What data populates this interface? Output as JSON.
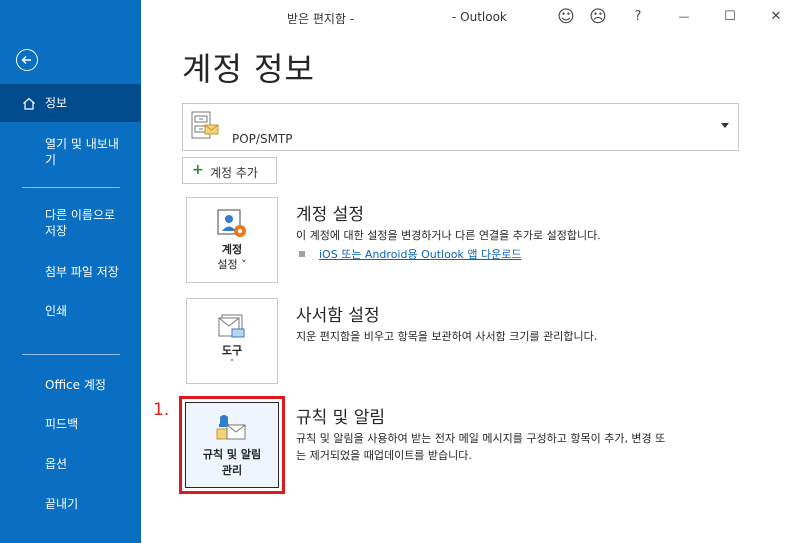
{
  "window": {
    "title_left": "받은 편지함 -",
    "title_right": "- Outlook",
    "smile_icon": "☺",
    "frown_icon": "☹",
    "help_label": "?",
    "minimize_label": "—",
    "maximize_label": "☐",
    "close_label": "✕"
  },
  "sidebar": {
    "items": [
      {
        "label": "정보"
      },
      {
        "label": "열기 및 내보내"
      },
      {
        "label": "기"
      },
      {
        "label": "다른 이름으로"
      },
      {
        "label": "저장"
      },
      {
        "label": "첨부 파일 저장"
      },
      {
        "label": "인쇄"
      },
      {
        "label": "Office 계정"
      },
      {
        "label": "피드백"
      },
      {
        "label": "옵션"
      },
      {
        "label": "끝내기"
      }
    ]
  },
  "main": {
    "page_title": "계정 정보",
    "account": {
      "selected": "POP/SMTP"
    },
    "add_account_label": "계정 추가",
    "sections": [
      {
        "tile_line1": "계정",
        "tile_line2": "설정 ˅",
        "title": "계정 설정",
        "desc": "이 계정에 대한 설정을 변경하거나 다른 연결을 추가로 설정합니다.",
        "link": "iOS 또는 Android용 Outlook 앱 다운로드"
      },
      {
        "tile_line1": "도구",
        "tile_chev": "˅",
        "title": "사서함 설정",
        "desc": "지운 편지함을 비우고 항목을 보관하여 사서함 크기를 관리합니다."
      },
      {
        "tile_line1": "규칙 및 알림",
        "tile_line2": "관리",
        "title": "규칙 및 알림",
        "desc_line1": "규칙 및 알림을 사용하여 받는 전자 메일 메시지를 구성하고 항목이 추가, 변경 또",
        "desc_line2": "는 제거되었을 때업데이트를 받습니다."
      }
    ],
    "annotation": "1."
  },
  "colors": {
    "sidebar_bg": "#0a6fc2",
    "sidebar_active": "#004b8c",
    "highlight": "#e0181c",
    "link": "#0b63b6"
  }
}
